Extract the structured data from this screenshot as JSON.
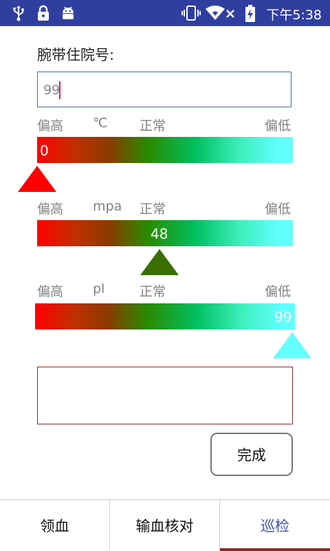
{
  "status_bar": {
    "time": "下午5:38",
    "icons_left": [
      "usb-icon",
      "lock-icon",
      "android-icon"
    ],
    "icons_right": [
      "vibrate-icon",
      "wifi-icon",
      "no-signal-icon",
      "battery-charging-icon"
    ],
    "background": "#303F9F"
  },
  "form": {
    "wristband_label": "腕带住院号:",
    "wristband_value": "99"
  },
  "gauges": [
    {
      "high_label": "偏高",
      "unit": "℃",
      "normal_label": "正常",
      "low_label": "偏低",
      "value": "0",
      "position": 0.0,
      "marker_color": "#ff0000"
    },
    {
      "high_label": "偏高",
      "unit": "mpa",
      "normal_label": "正常",
      "low_label": "偏低",
      "value": "48",
      "position": 0.48,
      "marker_color": "#3a6e00"
    },
    {
      "high_label": "偏高",
      "unit": "pl",
      "normal_label": "正常",
      "low_label": "偏低",
      "value": "99",
      "position": 0.99,
      "marker_color": "#66ffff"
    }
  ],
  "remark": {
    "value": ""
  },
  "actions": {
    "done_label": "完成"
  },
  "bottom_nav": {
    "tabs": [
      {
        "label": "领血",
        "active": false
      },
      {
        "label": "输血核对",
        "active": false
      },
      {
        "label": "巡检",
        "active": true
      }
    ],
    "active_color": "#3F51B5",
    "underline_color": "#8a2a2a"
  }
}
